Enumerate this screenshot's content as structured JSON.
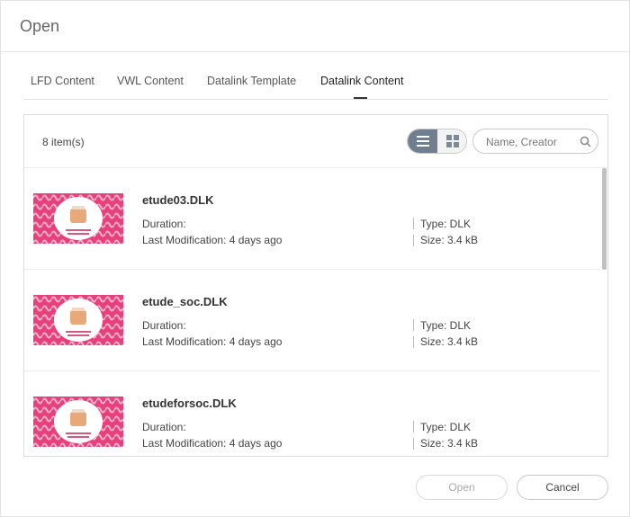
{
  "dialog": {
    "title": "Open"
  },
  "tabs": [
    {
      "label": "LFD Content",
      "active": false
    },
    {
      "label": "VWL Content",
      "active": false
    },
    {
      "label": "Datalink Template",
      "active": false
    },
    {
      "label": "Datalink Content",
      "active": true
    }
  ],
  "list": {
    "item_count": "8 item(s)",
    "view_modes": [
      "list-icon",
      "grid-icon"
    ],
    "active_view": "list",
    "search": {
      "placeholder": "Name, Creator",
      "value": ""
    },
    "items": [
      {
        "name": "etude03.DLK",
        "duration_label": "Duration:",
        "last_modification": "Last Modification: 4 days ago",
        "type": "Type: DLK",
        "size": "Size: 3.4 kB"
      },
      {
        "name": "etude_soc.DLK",
        "duration_label": "Duration:",
        "last_modification": "Last Modification: 4 days ago",
        "type": "Type: DLK",
        "size": "Size: 3.4 kB"
      },
      {
        "name": "etudeforsoc.DLK",
        "duration_label": "Duration:",
        "last_modification": "Last Modification: 4 days ago",
        "type": "Type: DLK",
        "size": "Size: 3.4 kB"
      }
    ]
  },
  "buttons": {
    "open_label": "Open",
    "open_enabled": false,
    "cancel_label": "Cancel"
  },
  "colors": {
    "thumbnail_pink": "#e8407a",
    "thumbnail_light": "#f7b3cc",
    "toggle_active": "#6f7f8f"
  }
}
